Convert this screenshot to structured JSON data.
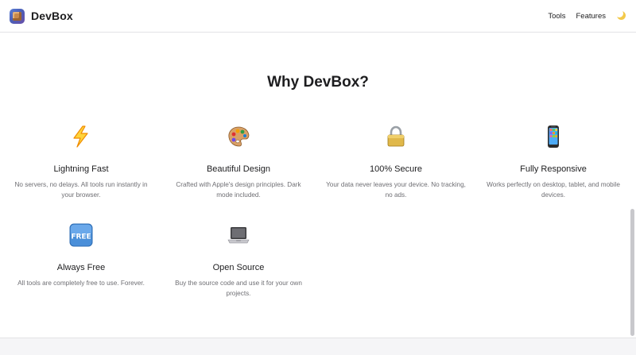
{
  "app": {
    "name": "DevBox"
  },
  "nav": {
    "links": [
      "Tools",
      "Features"
    ],
    "theme_toggle_icon": "moon-icon"
  },
  "section": {
    "title": "Why DevBox?"
  },
  "features": [
    {
      "icon": "lightning-icon",
      "title": "Lightning Fast",
      "desc": "No servers, no delays. All tools run instantly in your browser."
    },
    {
      "icon": "palette-icon",
      "title": "Beautiful Design",
      "desc": "Crafted with Apple's design principles. Dark mode included."
    },
    {
      "icon": "lock-icon",
      "title": "100% Secure",
      "desc": "Your data never leaves your device. No tracking, no ads."
    },
    {
      "icon": "phone-icon",
      "title": "Fully Responsive",
      "desc": "Works perfectly on desktop, tablet, and mobile devices."
    },
    {
      "icon": "free-icon",
      "title": "Always Free",
      "desc": "All tools are completely free to use. Forever."
    },
    {
      "icon": "laptop-icon",
      "title": "Open Source",
      "desc": "Buy the source code and use it for your own projects."
    }
  ],
  "colors": {
    "text": "#1d1d1f",
    "muted": "#6e6e73",
    "border": "#e3e3e6"
  }
}
